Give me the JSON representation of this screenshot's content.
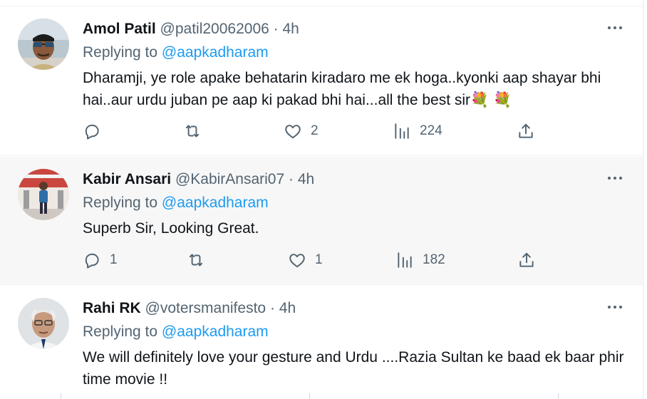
{
  "tweets": [
    {
      "name": "Amol Patil",
      "handle": "@patil20062006",
      "dot": "·",
      "time": "4h",
      "reply_prefix": "Replying to",
      "reply_mention": "@aapkadharam",
      "text": "Dharamji, ye role apake behatarin kiradaro me ek hoga..kyonki aap shayar bhi hai..aur urdu juban pe aap ki pakad bhi hai...all the best sir💐 💐",
      "replies": "",
      "retweets": "",
      "likes": "2",
      "views": "224"
    },
    {
      "name": "Kabir Ansari",
      "handle": "@KabirAnsari07",
      "dot": "·",
      "time": "4h",
      "reply_prefix": "Replying to",
      "reply_mention": "@aapkadharam",
      "text": "Superb Sir, Looking Great.",
      "replies": "1",
      "retweets": "",
      "likes": "1",
      "views": "182"
    },
    {
      "name": "Rahi RK",
      "handle": "@votersmanifesto",
      "dot": "·",
      "time": "4h",
      "reply_prefix": "Replying to",
      "reply_mention": "@aapkadharam",
      "text": "We will definitely love your gesture and Urdu ....Razia Sultan ke baad ek baar phir time movie !!"
    }
  ],
  "icons": {
    "reply": "reply-bubble-icon",
    "retweet": "retweet-icon",
    "like": "heart-icon",
    "views": "views-bar-icon",
    "share": "share-upload-icon",
    "more": "more-dots-icon"
  },
  "colors": {
    "mention": "#1d9bf0",
    "secondary_text": "#536471",
    "primary_text": "#0f1419",
    "hover_bg": "#f7f7f7"
  }
}
